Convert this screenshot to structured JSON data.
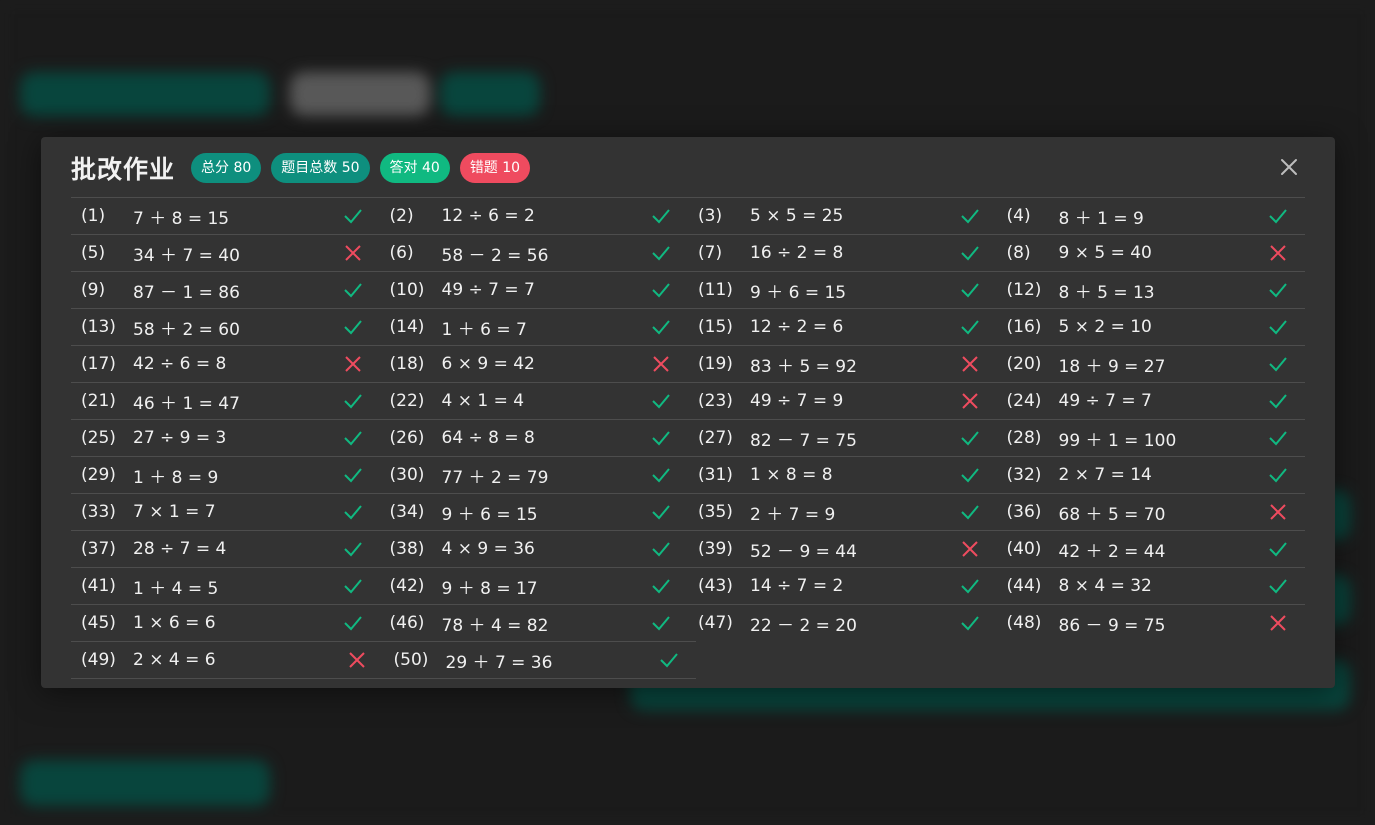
{
  "modal": {
    "title": "批改作业",
    "badges": {
      "total_score": "总分 80",
      "total_questions": "题目总数 50",
      "correct": "答对 40",
      "wrong": "错题 10"
    },
    "colors": {
      "teal": "#0e8f7e",
      "green": "#10b981",
      "red": "#ef4b5f"
    }
  },
  "items": [
    {
      "n": "(1)",
      "e": "7 ＋ 8 = 15",
      "ok": true
    },
    {
      "n": "(2)",
      "e": "12 ÷ 6 = 2",
      "ok": true
    },
    {
      "n": "(3)",
      "e": "5 × 5 = 25",
      "ok": true
    },
    {
      "n": "(4)",
      "e": "8 ＋ 1 = 9",
      "ok": true
    },
    {
      "n": "(5)",
      "e": "34 ＋ 7 = 40",
      "ok": false
    },
    {
      "n": "(6)",
      "e": "58 － 2 = 56",
      "ok": true
    },
    {
      "n": "(7)",
      "e": "16 ÷ 2 = 8",
      "ok": true
    },
    {
      "n": "(8)",
      "e": "9 × 5 = 40",
      "ok": false
    },
    {
      "n": "(9)",
      "e": "87 － 1 = 86",
      "ok": true
    },
    {
      "n": "(10)",
      "e": "49 ÷ 7 = 7",
      "ok": true
    },
    {
      "n": "(11)",
      "e": "9 ＋ 6 = 15",
      "ok": true
    },
    {
      "n": "(12)",
      "e": "8 ＋ 5 = 13",
      "ok": true
    },
    {
      "n": "(13)",
      "e": "58 ＋ 2 = 60",
      "ok": true
    },
    {
      "n": "(14)",
      "e": "1 ＋ 6 = 7",
      "ok": true
    },
    {
      "n": "(15)",
      "e": "12 ÷ 2 = 6",
      "ok": true
    },
    {
      "n": "(16)",
      "e": "5 × 2 = 10",
      "ok": true
    },
    {
      "n": "(17)",
      "e": "42 ÷ 6 = 8",
      "ok": false
    },
    {
      "n": "(18)",
      "e": "6 × 9 = 42",
      "ok": false
    },
    {
      "n": "(19)",
      "e": "83 ＋ 5 = 92",
      "ok": false
    },
    {
      "n": "(20)",
      "e": "18 ＋ 9 = 27",
      "ok": true
    },
    {
      "n": "(21)",
      "e": "46 ＋ 1 = 47",
      "ok": true
    },
    {
      "n": "(22)",
      "e": "4 × 1 = 4",
      "ok": true
    },
    {
      "n": "(23)",
      "e": "49 ÷ 7 = 9",
      "ok": false
    },
    {
      "n": "(24)",
      "e": "49 ÷ 7 = 7",
      "ok": true
    },
    {
      "n": "(25)",
      "e": "27 ÷ 9 = 3",
      "ok": true
    },
    {
      "n": "(26)",
      "e": "64 ÷ 8 = 8",
      "ok": true
    },
    {
      "n": "(27)",
      "e": "82 － 7 = 75",
      "ok": true
    },
    {
      "n": "(28)",
      "e": "99 ＋ 1 = 100",
      "ok": true
    },
    {
      "n": "(29)",
      "e": "1 ＋ 8 = 9",
      "ok": true
    },
    {
      "n": "(30)",
      "e": "77 ＋ 2 = 79",
      "ok": true
    },
    {
      "n": "(31)",
      "e": "1 × 8 = 8",
      "ok": true
    },
    {
      "n": "(32)",
      "e": "2 × 7 = 14",
      "ok": true
    },
    {
      "n": "(33)",
      "e": "7 × 1 = 7",
      "ok": true
    },
    {
      "n": "(34)",
      "e": "9 ＋ 6 = 15",
      "ok": true
    },
    {
      "n": "(35)",
      "e": "2 ＋ 7 = 9",
      "ok": true
    },
    {
      "n": "(36)",
      "e": "68 ＋ 5 = 70",
      "ok": false
    },
    {
      "n": "(37)",
      "e": "28 ÷ 7 = 4",
      "ok": true
    },
    {
      "n": "(38)",
      "e": "4 × 9 = 36",
      "ok": true
    },
    {
      "n": "(39)",
      "e": "52 － 9 = 44",
      "ok": false
    },
    {
      "n": "(40)",
      "e": "42 ＋ 2 = 44",
      "ok": true
    },
    {
      "n": "(41)",
      "e": "1 ＋ 4 = 5",
      "ok": true
    },
    {
      "n": "(42)",
      "e": "9 ＋ 8 = 17",
      "ok": true
    },
    {
      "n": "(43)",
      "e": "14 ÷ 7 = 2",
      "ok": true
    },
    {
      "n": "(44)",
      "e": "8 × 4 = 32",
      "ok": true
    },
    {
      "n": "(45)",
      "e": "1 × 6 = 6",
      "ok": true
    },
    {
      "n": "(46)",
      "e": "78 ＋ 4 = 82",
      "ok": true
    },
    {
      "n": "(47)",
      "e": "22 － 2 = 20",
      "ok": true
    },
    {
      "n": "(48)",
      "e": "86 － 9 = 75",
      "ok": false
    },
    {
      "n": "(49)",
      "e": "2 × 4 = 6",
      "ok": false
    },
    {
      "n": "(50)",
      "e": "29 ＋ 7 = 36",
      "ok": true
    }
  ]
}
